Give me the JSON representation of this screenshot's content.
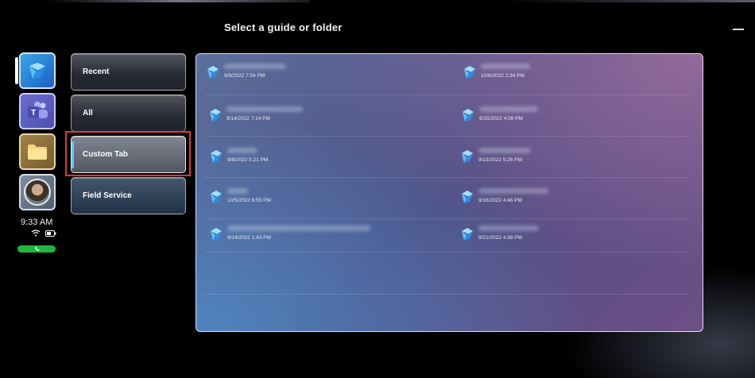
{
  "header": {
    "title": "Select a guide or folder"
  },
  "rail": {
    "apps": [
      {
        "name": "Guides",
        "icon": "guides-app-icon"
      },
      {
        "name": "Teams",
        "icon": "teams-app-icon",
        "letter": "T"
      },
      {
        "name": "Files",
        "icon": "folder-icon"
      },
      {
        "name": "Profile",
        "icon": "avatar"
      }
    ],
    "time": "9:33 AM",
    "status_icons": [
      "wifi-icon",
      "battery-icon"
    ],
    "call": "phone-icon"
  },
  "categories": {
    "items": [
      {
        "label": "Recent"
      },
      {
        "label": "All"
      },
      {
        "label": "Custom Tab",
        "selected": true
      },
      {
        "label": "Field Service"
      }
    ]
  },
  "guides": {
    "left": [
      {
        "date": "9/9/2022 7:54 PM"
      },
      {
        "date": "9/14/2022 7:14 PM"
      },
      {
        "date": "9/8/2022 5:21 PM"
      },
      {
        "date": "10/5/2022 6:55 PM"
      },
      {
        "date": "9/14/2022 1:43 PM"
      }
    ],
    "right": [
      {
        "date": "10/6/2022 2:34 PM"
      },
      {
        "date": "9/15/2022 4:08 PM"
      },
      {
        "date": "9/13/2022 5:26 PM"
      },
      {
        "date": "9/16/2022 4:46 PM"
      },
      {
        "date": "9/21/2022 4:38 PM"
      }
    ]
  },
  "colors": {
    "accent": "#4fd2ff",
    "highlight": "#e03a3a",
    "call_green": "#1fb83c"
  }
}
